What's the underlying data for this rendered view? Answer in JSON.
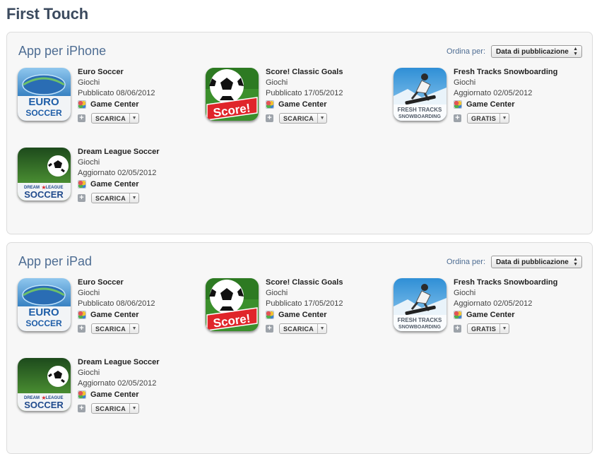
{
  "developer": "First Touch",
  "sort_label": "Ordina per:",
  "sort_value": "Data di pubblicazione",
  "game_center": "Game Center",
  "sections": [
    {
      "title": "App per iPhone",
      "apps": [
        {
          "name": "Euro Soccer",
          "category": "Giochi",
          "date": "Pubblicato 08/06/2012",
          "button": "SCARICA",
          "icon": "euro-soccer-icon"
        },
        {
          "name": "Score! Classic Goals",
          "category": "Giochi",
          "date": "Pubblicato 17/05/2012",
          "button": "SCARICA",
          "icon": "score-icon"
        },
        {
          "name": "Fresh Tracks Snowboarding",
          "category": "Giochi",
          "date": "Aggiornato 02/05/2012",
          "button": "GRATIS",
          "icon": "fresh-tracks-icon"
        },
        {
          "name": "Dream League Soccer",
          "category": "Giochi",
          "date": "Aggiornato 02/05/2012",
          "button": "SCARICA",
          "icon": "dream-league-icon"
        }
      ]
    },
    {
      "title": "App per iPad",
      "apps": [
        {
          "name": "Euro Soccer",
          "category": "Giochi",
          "date": "Pubblicato 08/06/2012",
          "button": "SCARICA",
          "icon": "euro-soccer-icon"
        },
        {
          "name": "Score! Classic Goals",
          "category": "Giochi",
          "date": "Pubblicato 17/05/2012",
          "button": "SCARICA",
          "icon": "score-icon"
        },
        {
          "name": "Fresh Tracks Snowboarding",
          "category": "Giochi",
          "date": "Aggiornato 02/05/2012",
          "button": "GRATIS",
          "icon": "fresh-tracks-icon"
        },
        {
          "name": "Dream League Soccer",
          "category": "Giochi",
          "date": "Aggiornato 02/05/2012",
          "button": "SCARICA",
          "icon": "dream-league-icon"
        }
      ]
    }
  ],
  "icon_text": {
    "euro": "EURO",
    "soccer": "SOCCER",
    "score": "Score!",
    "fresh": "FRESH TRACKS",
    "snowboarding": "SNOWBOARDING",
    "dream": "DREAM",
    "league": "LEAGUE",
    "soccer_caps": "SOCCER"
  }
}
